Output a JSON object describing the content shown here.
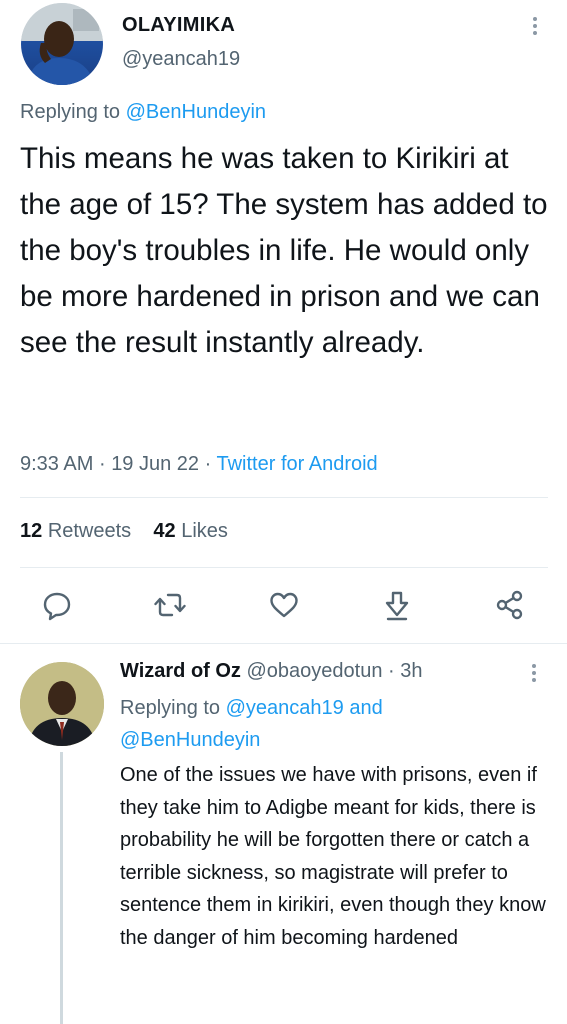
{
  "tweet": {
    "author_name": "OLAYIMIKA",
    "author_handle": "@yeancah19",
    "replying_prefix": "Replying to",
    "replying_to": "@BenHundeyin",
    "text": "This means he was taken to Kirikiri at the age of 15? The system has added to the boy's troubles in life. He would only be more hardened in prison and we can see the result instantly already.",
    "time": "9:33 AM",
    "date": "19 Jun 22",
    "source": "Twitter for Android",
    "retweets_count": "12",
    "retweets_label": "Retweets",
    "likes_count": "42",
    "likes_label": "Likes"
  },
  "actions": [
    "reply-icon",
    "retweet-icon",
    "like-icon",
    "download-icon",
    "share-icon"
  ],
  "reply": {
    "author_name": "Wizard of Oz",
    "author_handle": "@obaoyedotun",
    "time_ago": "3h",
    "replying_prefix": "Replying to",
    "replying_to_1": "@yeancah19",
    "conjunction": "and",
    "replying_to_2": "@BenHundeyin",
    "text": "One of the issues we have with prisons, even if they take him to Adigbe meant for kids, there is probability he will be forgotten there or catch a terrible sickness, so magistrate will prefer to sentence them in kirikiri, even though they know the danger of him becoming hardened"
  },
  "colors": {
    "accent": "#1d9bf0",
    "muted": "#536471",
    "text": "#0f1419"
  }
}
